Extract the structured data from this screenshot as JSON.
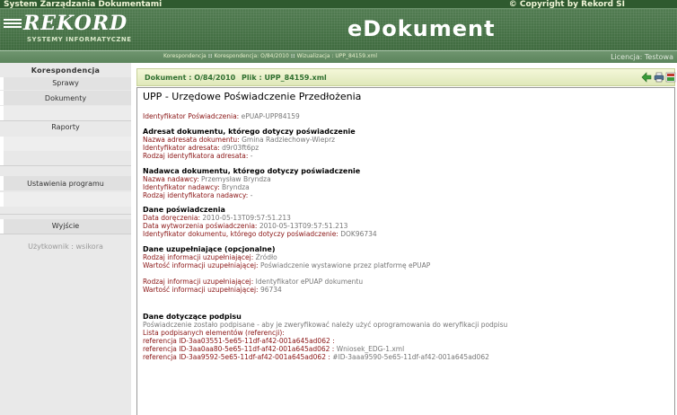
{
  "header": {
    "system_title": "System Zarządzania Dokumentami",
    "copyright": "© Copyright by Rekord SI",
    "logo_text": "REKORD",
    "logo_subtitle": "SYSTEMY INFORMATYCZNE",
    "app_title": "eDokument"
  },
  "breadcrumb": {
    "items": [
      "Korespondencja",
      "Korespondencja: O/84/2010",
      "Wizualizacja : UPP_84159.xml"
    ],
    "separator": "::"
  },
  "licence": "Licencja: Testowa",
  "sidebar": {
    "items": [
      {
        "label": "Korespondencja"
      },
      {
        "label": "Sprawy"
      },
      {
        "label": "Dokumenty"
      },
      {
        "label": "Raporty"
      },
      {
        "label": "Ustawienia programu"
      },
      {
        "label": "Wyjście"
      }
    ],
    "user": "Użytkownik : wsikora"
  },
  "document_bar": {
    "document": "Dokument : O/84/2010",
    "file": "Plik : UPP_84159.xml",
    "icons": [
      "back-arrow-icon",
      "print-icon",
      "export-icon"
    ]
  },
  "document": {
    "heading": "UPP - Urzędowe Poświadczenie Przedłożenia",
    "id_label": "Identyfikator Poświadczenia:",
    "id_value": "ePUAP-UPP84159",
    "sections": {
      "addressee": {
        "title": "Adresat dokumentu, którego dotyczy poświadczenie",
        "rows": [
          {
            "label": "Nazwa adresata dokumentu:",
            "value": "Gmina Radziechowy-Wieprz"
          },
          {
            "label": "Identyfikator adresata:",
            "value": "d9r03ft6pz"
          },
          {
            "label": "Rodzaj identyfikatora adresata:",
            "value": "-"
          }
        ]
      },
      "sender": {
        "title": "Nadawca dokumentu, którego dotyczy poświadczenie",
        "rows": [
          {
            "label": "Nazwa nadawcy:",
            "value": "Przemysław Bryndza"
          },
          {
            "label": "Identyfikator nadawcy:",
            "value": "Bryndza"
          },
          {
            "label": "Rodzaj identyfikatora nadawcy:",
            "value": "-"
          }
        ]
      },
      "certification": {
        "title": "Dane poświadczenia",
        "rows": [
          {
            "label": "Data doręczenia:",
            "value": "2010-05-13T09:57:51.213"
          },
          {
            "label": "Data wytworzenia poświadczenia:",
            "value": "2010-05-13T09:57:51.213"
          },
          {
            "label": "Identyfikator dokumentu, którego dotyczy poświadczenie:",
            "value": "DOK96734"
          }
        ]
      },
      "supplementary": {
        "title": "Dane uzupełniające (opcjonalne)",
        "rows": [
          {
            "label": "Rodzaj informacji uzupełniającej:",
            "value": "Źródło"
          },
          {
            "label": "Wartość informacji uzupełniającej:",
            "value": "Poświadczenie wystawione przez platformę ePUAP"
          },
          {
            "label": "Rodzaj informacji uzupełniającej:",
            "value": "Identyfikator ePUAP dokumentu"
          },
          {
            "label": "Wartość informacji uzupełniającej:",
            "value": "96734"
          }
        ]
      },
      "signature": {
        "title": "Dane dotyczące podpisu",
        "note": "Poświadczenie zostało podpisane - aby je zweryfikować należy użyć oprogramowania do weryfikacji podpisu",
        "list_label": "Lista podpisanych elementów (referencji):",
        "refs": [
          {
            "label": "referencja ID-3aa03551-5e65-11df-af42-001a645ad062 :",
            "value": ""
          },
          {
            "label": "referencja ID-3aa0aa80-5e65-11df-af42-001a645ad062 :",
            "value": "Wniosek_EDG-1.xml"
          },
          {
            "label": "referencja ID-3aa9592-5e65-11df-af42-001a645ad062 :",
            "value": "#ID-3aaa9590-5e65-11df-af42-001a645ad062"
          }
        ]
      }
    }
  }
}
